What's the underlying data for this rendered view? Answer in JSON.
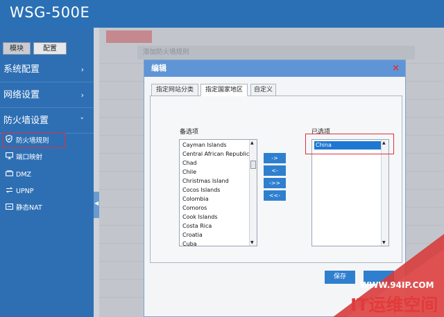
{
  "header": {
    "product": "WSG-500E"
  },
  "sidebar": {
    "tabs": [
      "模块",
      "配置"
    ],
    "sections": [
      {
        "label": "系统配置",
        "chevron": "›"
      },
      {
        "label": "网络设置",
        "chevron": "›"
      },
      {
        "label": "防火墙设置",
        "chevron": "˅"
      }
    ],
    "items": [
      {
        "label": "防火墙规则",
        "icon": "shield-icon"
      },
      {
        "label": "端口映射",
        "icon": "monitor-icon"
      },
      {
        "label": "DMZ",
        "icon": "dmz-icon"
      },
      {
        "label": "UPNP",
        "icon": "exchange-icon"
      },
      {
        "label": "静态NAT",
        "icon": "nat-icon"
      }
    ]
  },
  "background": {
    "dialog_title": "添加防火墙规则"
  },
  "modal": {
    "title": "编辑",
    "close": "×",
    "tabs": [
      "指定网站分类",
      "指定国家地区",
      "自定义"
    ],
    "active_tab": "指定国家地区",
    "available_label": "备选项",
    "selected_label": "已选项",
    "available_options": [
      "Cayman Islands",
      "Central African Republic",
      "Chad",
      "Chile",
      "Christmas Island",
      "Cocos Islands",
      "Colombia",
      "Comoros",
      "Cook Islands",
      "Costa Rica",
      "Croatia",
      "Cuba"
    ],
    "selected_options": [
      "China"
    ],
    "move_buttons": [
      "->",
      "<-",
      "->>",
      "<<-"
    ],
    "save_label": "保存"
  },
  "watermark": {
    "url": "WWW.94IP.COM",
    "brand": "IT运维空间"
  },
  "colors": {
    "header_blue": "#2b70b5",
    "sidebar_blue": "#2e6fb4",
    "modal_head": "#5f95d6",
    "button_blue": "#2f7fcf",
    "highlight_red": "#e0303a"
  }
}
